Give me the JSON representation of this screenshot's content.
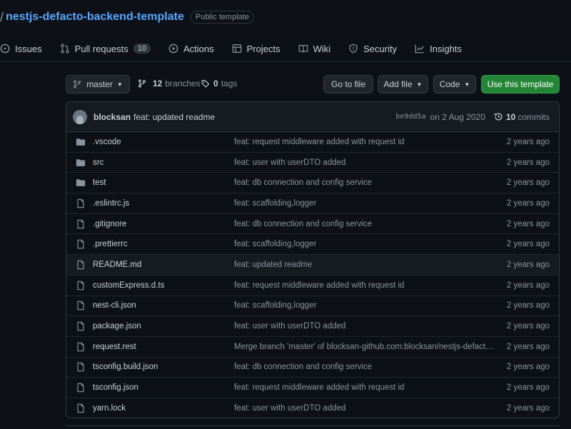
{
  "repo": {
    "slash": "/",
    "name": "nestjs-defacto-backend-template",
    "visibility": "Public template"
  },
  "tabs": [
    {
      "label": "Issues",
      "icon": "issue-icon"
    },
    {
      "label": "Pull requests",
      "icon": "pull-request-icon",
      "count": "10"
    },
    {
      "label": "Actions",
      "icon": "play-icon"
    },
    {
      "label": "Projects",
      "icon": "table-icon"
    },
    {
      "label": "Wiki",
      "icon": "book-icon"
    },
    {
      "label": "Security",
      "icon": "shield-icon"
    },
    {
      "label": "Insights",
      "icon": "graph-icon"
    }
  ],
  "toolbar": {
    "branch": "master",
    "branches_count": "12",
    "branches_label": "branches",
    "tags_count": "0",
    "tags_label": "tags",
    "go_to_file": "Go to file",
    "add_file": "Add file",
    "code": "Code",
    "use_template": "Use this template"
  },
  "last_commit": {
    "author": "blocksan",
    "message": "feat: updated readme",
    "sha": "be9dd5a",
    "date": "on 2 Aug 2020",
    "count": "10",
    "count_label": "commits"
  },
  "files": [
    {
      "type": "dir",
      "name": ".vscode",
      "message": "feat: request middleware added with request id",
      "age": "2 years ago"
    },
    {
      "type": "dir",
      "name": "src",
      "message": "feat: user with userDTO added",
      "age": "2 years ago"
    },
    {
      "type": "dir",
      "name": "test",
      "message": "feat: db connection and config service",
      "age": "2 years ago"
    },
    {
      "type": "file",
      "name": ".eslintrc.js",
      "message": "feat: scaffolding,logger",
      "age": "2 years ago"
    },
    {
      "type": "file",
      "name": ".gitignore",
      "message": "feat: db connection and config service",
      "age": "2 years ago"
    },
    {
      "type": "file",
      "name": ".prettierrc",
      "message": "feat: scaffolding,logger",
      "age": "2 years ago"
    },
    {
      "type": "file",
      "name": "README.md",
      "message": "feat: updated readme",
      "age": "2 years ago"
    },
    {
      "type": "file",
      "name": "customExpress.d.ts",
      "message": "feat: request middleware added with request id",
      "age": "2 years ago"
    },
    {
      "type": "file",
      "name": "nest-cli.json",
      "message": "feat: scaffolding,logger",
      "age": "2 years ago"
    },
    {
      "type": "file",
      "name": "package.json",
      "message": "feat: user with userDTO added",
      "age": "2 years ago"
    },
    {
      "type": "file",
      "name": "request.rest",
      "message": "Merge branch 'master' of blocksan-github.com:blocksan/nestjs-defacto-…",
      "age": "2 years ago"
    },
    {
      "type": "file",
      "name": "tsconfig.build.json",
      "message": "feat: db connection and config service",
      "age": "2 years ago"
    },
    {
      "type": "file",
      "name": "tsconfig.json",
      "message": "feat: request middleware added with request id",
      "age": "2 years ago"
    },
    {
      "type": "file",
      "name": "yarn.lock",
      "message": "feat: user with userDTO added",
      "age": "2 years ago"
    }
  ],
  "colors": {
    "background": "#0d1117",
    "link": "#58a6ff",
    "primary_button": "#238636",
    "muted_text": "#8b949e"
  }
}
